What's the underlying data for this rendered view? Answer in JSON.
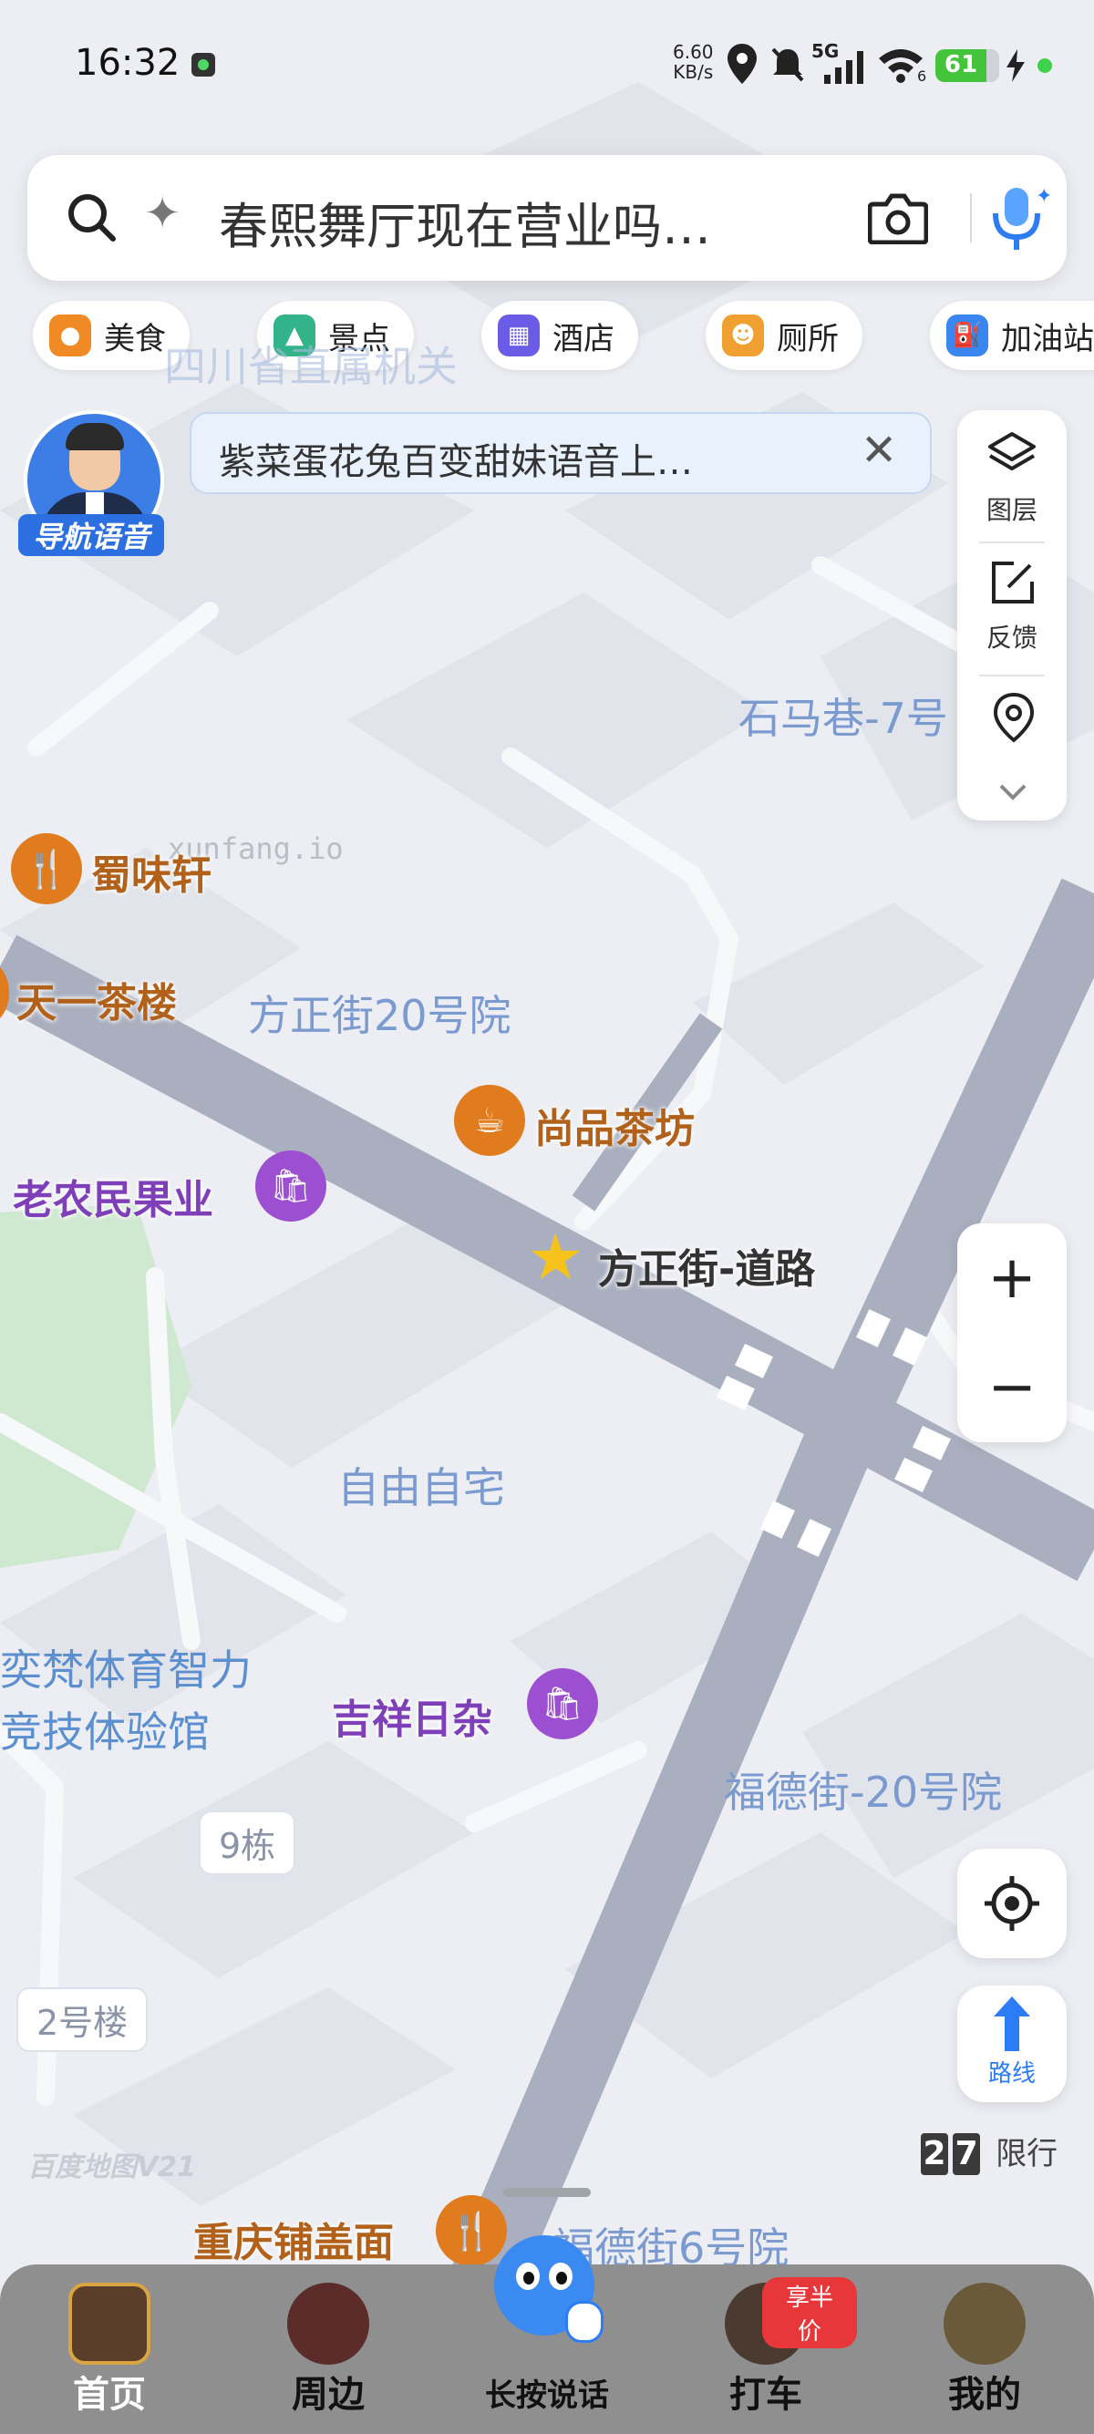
{
  "status": {
    "time": "16:32",
    "net_speed": "6.60",
    "net_unit": "KB/s",
    "signal": "5G",
    "wifi_num": "6",
    "battery": "61"
  },
  "search": {
    "text": "春熙舞厅现在营业吗…"
  },
  "categories": [
    {
      "label": "美食",
      "color": "#f08a24",
      "icon": "food-icon"
    },
    {
      "label": "景点",
      "color": "#33b38a",
      "icon": "scenery-icon"
    },
    {
      "label": "酒店",
      "color": "#6b5ce7",
      "icon": "hotel-icon"
    },
    {
      "label": "厕所",
      "color": "#f0a030",
      "icon": "toilet-icon"
    },
    {
      "label": "加油站",
      "color": "#3a86f0",
      "icon": "gas-station-icon"
    }
  ],
  "nav_voice": {
    "label": "导航语音"
  },
  "banner": {
    "text": "紫菜蛋花兔百变甜妹语音上…"
  },
  "side_panel": {
    "layers": "图层",
    "feedback": "反馈"
  },
  "map_labels": {
    "shimaxiang": "石马巷-7号",
    "fangzheng20": "方正街20号院",
    "ziyou": "自由自宅",
    "fude20": "福德街-20号院",
    "fude6": "福德街6号院",
    "yifan1": "奕梵体育智力",
    "yifan2": "竞技体验馆",
    "bldg9": "9栋",
    "bldg2": "2号楼",
    "sichuan": "四川省直属机关",
    "watermark": "xunfang.io",
    "baidu_mark": "百度地图V21"
  },
  "pois": {
    "shuweixuan": "蜀味轩",
    "tianyi": "天一茶楼",
    "shangpin": "尚品茶坊",
    "laonongmin": "老农民果业",
    "fangzheng_road": "方正街-道路",
    "jixiang": "吉祥日杂",
    "chongqing": "重庆铺盖面"
  },
  "controls": {
    "route": "路线",
    "restriction_nums": [
      "2",
      "7"
    ],
    "restriction_label": "限行"
  },
  "bottom_nav": {
    "home": "首页",
    "nearby": "周边",
    "voice": "长按说话",
    "taxi": "打车",
    "taxi_badge": "享半价",
    "mine": "我的"
  },
  "colors": {
    "road": "#a9afbf",
    "accent_blue": "#2c7cf6",
    "poi_orange": "#e07c1e",
    "poi_purple": "#9c4fd1"
  }
}
